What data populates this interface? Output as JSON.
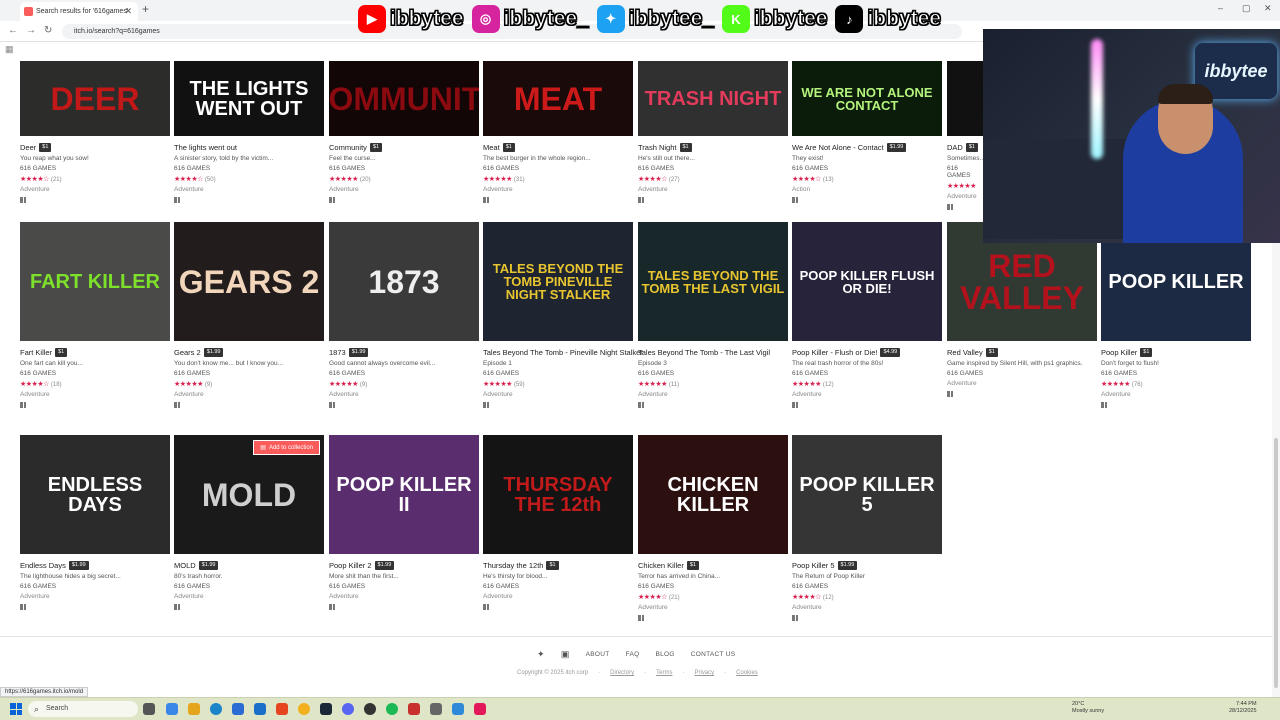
{
  "browser": {
    "tab_title": "Search results for '616games'",
    "url": "itch.io/search?q=616games",
    "new_tab": "+",
    "window_controls": [
      "–",
      "▢",
      "✕"
    ]
  },
  "social_overlay": [
    {
      "platform": "youtube",
      "handle": "ibbytee",
      "color": "#ff0000",
      "glyph": "▶"
    },
    {
      "platform": "instagram",
      "handle": "ibbytee_",
      "color": "#d6249f",
      "glyph": "◎"
    },
    {
      "platform": "twitter",
      "handle": "ibbytee_",
      "color": "#1da1f2",
      "glyph": "✦"
    },
    {
      "platform": "kick",
      "handle": "ibbytee",
      "color": "#53fc18",
      "glyph": "K"
    },
    {
      "platform": "tiktok",
      "handle": "ibbytee",
      "color": "#000000",
      "glyph": "♪"
    }
  ],
  "webcam": {
    "sign_text": "ibbytee"
  },
  "games_row1": [
    {
      "title": "Deer",
      "price": "$1",
      "desc": "You reap what you sow!",
      "author": "616 GAMES",
      "stars": "★★★★☆",
      "count": "(21)",
      "genre": "Adventure",
      "thumb_text": "DEER",
      "bg": "#2c2c2a",
      "fg": "#c21818"
    },
    {
      "title": "The lights went out",
      "price": "",
      "desc": "A sinister story, told by the victim...",
      "author": "616 GAMES",
      "stars": "★★★★☆",
      "count": "(50)",
      "genre": "Adventure",
      "thumb_text": "THE LIGHTS WENT OUT",
      "bg": "#111111",
      "fg": "#ffffff"
    },
    {
      "title": "Community",
      "price": "$1",
      "desc": "Feel the curse...",
      "author": "616 GAMES",
      "stars": "★★★★★",
      "count": "(20)",
      "genre": "Adventure",
      "thumb_text": "COMMUNITY",
      "bg": "#120606",
      "fg": "#8a0a10"
    },
    {
      "title": "Meat",
      "price": "$1",
      "desc": "The best burger in the whole region...",
      "author": "616 GAMES",
      "stars": "★★★★★",
      "count": "(31)",
      "genre": "Adventure",
      "thumb_text": "MEAT",
      "bg": "#1a0a0a",
      "fg": "#cc1a1a"
    },
    {
      "title": "Trash Night",
      "price": "$1",
      "desc": "He's still out there...",
      "author": "616 GAMES",
      "stars": "★★★★☆",
      "count": "(27)",
      "genre": "Adventure",
      "thumb_text": "TRASH NIGHT",
      "bg": "#303030",
      "fg": "#e33b5b"
    },
    {
      "title": "We Are Not Alone - Contact",
      "price": "$1.99",
      "desc": "They exist!",
      "author": "616 GAMES",
      "stars": "★★★★☆",
      "count": "(13)",
      "genre": "Action",
      "thumb_text": "WE ARE NOT ALONE CONTACT",
      "bg": "#0b1c0b",
      "fg": "#b4f37c"
    },
    {
      "title": "DAD",
      "price": "$1",
      "desc": "Sometimes...",
      "author": "616 GAMES",
      "stars": "★★★★★",
      "count": "",
      "genre": "Adventure",
      "thumb_text": "D",
      "bg": "#111111",
      "fg": "#dddddd"
    }
  ],
  "games_row2": [
    {
      "title": "Fart Killer",
      "price": "$1",
      "desc": "One fart can kill you...",
      "author": "616 GAMES",
      "stars": "★★★★☆",
      "count": "(18)",
      "genre": "Adventure",
      "thumb_text": "FART KILLER",
      "bg": "#4a4a48",
      "fg": "#7de02b"
    },
    {
      "title": "Gears 2",
      "price": "$1.99",
      "desc": "You don't know me... but I know you...",
      "author": "616 GAMES",
      "stars": "★★★★★",
      "count": "(9)",
      "genre": "Adventure",
      "thumb_text": "GEARS 2",
      "bg": "#231c1c",
      "fg": "#f1d6bc"
    },
    {
      "title": "1873",
      "price": "$1.99",
      "desc": "Good cannot always overcome evil...",
      "author": "616 GAMES",
      "stars": "★★★★★",
      "count": "(9)",
      "genre": "Adventure",
      "thumb_text": "1873",
      "bg": "#3a3a3a",
      "fg": "#eeeeee"
    },
    {
      "title": "Tales Beyond The Tomb - Pineville Night Stalker",
      "price": "",
      "desc": "Episode 1",
      "author": "616 GAMES",
      "stars": "★★★★★",
      "count": "(59)",
      "genre": "Adventure",
      "thumb_text": "TALES BEYOND THE TOMB PINEVILLE NIGHT STALKER",
      "bg": "#1e2530",
      "fg": "#e8c530"
    },
    {
      "title": "Tales Beyond The Tomb - The Last Vigil",
      "price": "",
      "desc": "Episode 3",
      "author": "616 GAMES",
      "stars": "★★★★★",
      "count": "(11)",
      "genre": "Adventure",
      "thumb_text": "TALES BEYOND THE TOMB THE LAST VIGIL",
      "bg": "#18282a",
      "fg": "#e8c530"
    },
    {
      "title": "Poop Killer - Flush or Die!",
      "price": "$4.99",
      "desc": "The real trash horror of the 80s!",
      "author": "616 GAMES",
      "stars": "★★★★★",
      "count": "(12)",
      "genre": "Adventure",
      "thumb_text": "POOP KILLER FLUSH OR DIE!",
      "bg": "#26233a",
      "fg": "#ffffff"
    },
    {
      "title": "Red Valley",
      "price": "$1",
      "desc": "Game inspired by Silent Hill, with ps1 graphics.",
      "author": "616 GAMES",
      "stars": "",
      "count": "",
      "genre": "Adventure",
      "thumb_text": "RED VALLEY",
      "bg": "#303a33",
      "fg": "#b3121d"
    },
    {
      "title": "Poop Killer",
      "price": "$1",
      "desc": "Don't forget to flush!",
      "author": "616 GAMES",
      "stars": "★★★★★",
      "count": "(76)",
      "genre": "Adventure",
      "thumb_text": "POOP KILLER",
      "bg": "#1d2a44",
      "fg": "#ffffff"
    }
  ],
  "games_row3": [
    {
      "title": "Endless Days",
      "price": "$1.99",
      "desc": "The lighthouse hides a big secret...",
      "author": "616 GAMES",
      "stars": "",
      "count": "",
      "genre": "Adventure",
      "thumb_text": "ENDLESS DAYS",
      "bg": "#2b2b2b",
      "fg": "#ffffff"
    },
    {
      "title": "MOLD",
      "price": "$1.99",
      "desc": "80's trash horror.",
      "author": "616 GAMES",
      "stars": "",
      "count": "",
      "genre": "Adventure",
      "thumb_text": "MOLD",
      "bg": "#1a1a1a",
      "fg": "#cfcfcf"
    },
    {
      "title": "Poop Killer 2",
      "price": "$1.99",
      "desc": "More shit than the first...",
      "author": "616 GAMES",
      "stars": "",
      "count": "",
      "genre": "Adventure",
      "thumb_text": "POOP KILLER II",
      "bg": "#5a2d6e",
      "fg": "#ffffff"
    },
    {
      "title": "Thursday the 12th",
      "price": "$1",
      "desc": "He's thirsty for blood...",
      "author": "616 GAMES",
      "stars": "",
      "count": "",
      "genre": "Adventure",
      "thumb_text": "THURSDAY THE 12th",
      "bg": "#141414",
      "fg": "#c01a1a"
    },
    {
      "title": "Chicken Killer",
      "price": "$1",
      "desc": "Terror has arrived in China...",
      "author": "616 GAMES",
      "stars": "★★★★☆",
      "count": "(21)",
      "genre": "Adventure",
      "thumb_text": "CHICKEN KILLER",
      "bg": "#2c1010",
      "fg": "#ffffff"
    },
    {
      "title": "Poop Killer 5",
      "price": "$1.99",
      "desc": "The Return of Poop Killer",
      "author": "616 GAMES",
      "stars": "★★★★☆",
      "count": "(12)",
      "genre": "Adventure",
      "thumb_text": "POOP KILLER 5",
      "bg": "#353535",
      "fg": "#ffffff"
    }
  ],
  "add_to_collection": "Add to collection",
  "footer": {
    "links": [
      "ABOUT",
      "FAQ",
      "BLOG",
      "CONTACT US"
    ],
    "copyright": "Copyright © 2025 itch corp",
    "sublinks": [
      "Directory",
      "Terms",
      "Privacy",
      "Cookies"
    ],
    "separator": "·"
  },
  "status_url": "https://616games.itch.io/mold",
  "taskbar": {
    "search_placeholder": "Search",
    "weather_temp": "20°C",
    "weather_desc": "Mostly sunny",
    "time": "7:44 PM",
    "date": "28/12/2025"
  }
}
